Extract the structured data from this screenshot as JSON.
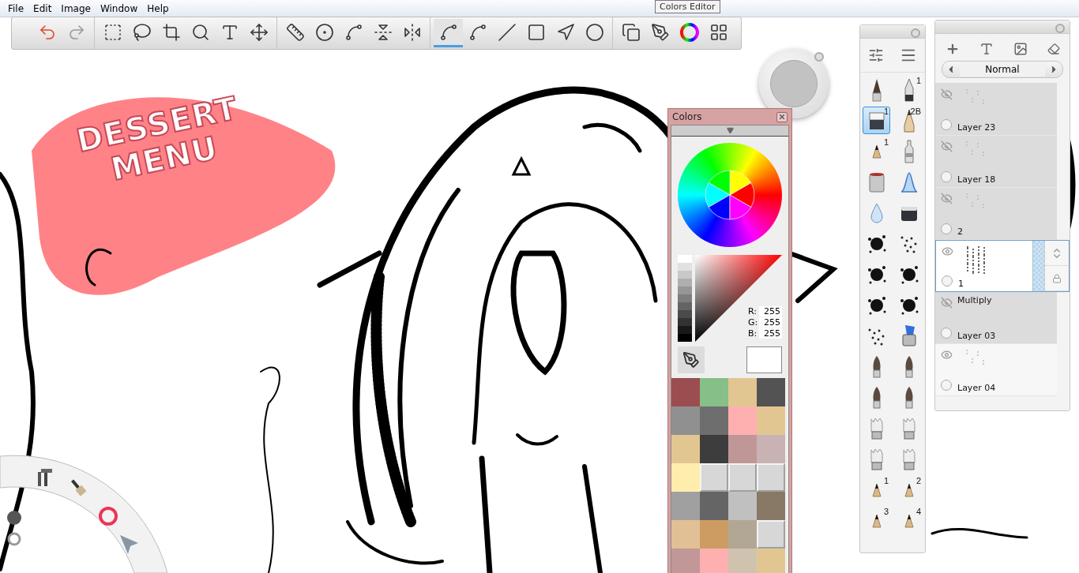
{
  "menu": [
    "File",
    "Edit",
    "Image",
    "Window",
    "Help"
  ],
  "tooltip": "Colors Editor",
  "toolbar": {
    "groups": [
      {
        "tools": [
          {
            "selected": false
          },
          {
            "selected": false
          }
        ]
      },
      {
        "tools": [
          {
            "selected": false
          },
          {
            "selected": false
          },
          {
            "selected": false
          },
          {
            "selected": false
          },
          {
            "selected": false
          },
          {
            "selected": false
          }
        ]
      },
      {
        "tools": [
          {
            "selected": false
          },
          {
            "selected": false
          },
          {
            "selected": false
          },
          {
            "selected": false
          },
          {
            "selected": false
          }
        ]
      },
      {
        "tools": [
          {
            "selected": true
          },
          {
            "selected": false
          },
          {
            "selected": false
          },
          {
            "selected": false
          },
          {
            "selected": false
          },
          {
            "selected": false
          }
        ]
      },
      {
        "tools": [
          {
            "selected": false
          },
          {
            "selected": false
          },
          {
            "selected": false
          },
          {
            "selected": false
          }
        ]
      }
    ]
  },
  "canvas_art": {
    "lettering": [
      "DESSERT",
      "MENU"
    ]
  },
  "colors_panel": {
    "title": "Colors",
    "rgb": [
      {
        "label": "R:",
        "value": "255"
      },
      {
        "label": "G:",
        "value": "255"
      },
      {
        "label": "B:",
        "value": "255"
      }
    ],
    "swatches": [
      {
        "color": "#9b4d4f",
        "empty": false
      },
      {
        "color": "#86bf88",
        "empty": false
      },
      {
        "color": "#e2c692",
        "empty": false
      },
      {
        "color": "#535353",
        "empty": false
      },
      {
        "color": "#909090",
        "empty": false
      },
      {
        "color": "#6e6e6e",
        "empty": false
      },
      {
        "color": "#feb0b0",
        "empty": false
      },
      {
        "color": "#e2c692",
        "empty": false
      },
      {
        "color": "#e2c692",
        "empty": false
      },
      {
        "color": "#3d3d3d",
        "empty": false
      },
      {
        "color": "#c09797",
        "empty": false
      },
      {
        "color": "#c9b2b4",
        "empty": false
      },
      {
        "color": "#ffedae",
        "empty": false
      },
      {
        "color": "#d7d7d7",
        "empty": true
      },
      {
        "color": "#d7d7d7",
        "empty": true
      },
      {
        "color": "#d7d7d7",
        "empty": true
      },
      {
        "color": "#a0a0a0",
        "empty": false
      },
      {
        "color": "#656565",
        "empty": false
      },
      {
        "color": "#c0c0c0",
        "empty": false
      },
      {
        "color": "#877966",
        "empty": false
      },
      {
        "color": "#e1c095",
        "empty": false
      },
      {
        "color": "#cd9c62",
        "empty": false
      },
      {
        "color": "#b1a794",
        "empty": false
      },
      {
        "color": "#d7d7d7",
        "empty": true
      },
      {
        "color": "#c19797",
        "empty": false
      },
      {
        "color": "#feafaf",
        "empty": false
      },
      {
        "color": "#cfc3b0",
        "empty": false
      },
      {
        "color": "#e2c692",
        "empty": false
      }
    ]
  },
  "brushes": [
    {
      "kind": "tip",
      "selected": false
    },
    {
      "kind": "pen",
      "badge": "1",
      "selected": false
    },
    {
      "kind": "eraser",
      "badge": "1",
      "selected": true
    },
    {
      "kind": "pencil",
      "badge": "2B",
      "selected": false
    },
    {
      "kind": "nib",
      "badge": "1",
      "selected": false
    },
    {
      "kind": "marker",
      "selected": false
    },
    {
      "kind": "bucket",
      "selected": false
    },
    {
      "kind": "shape",
      "selected": false
    },
    {
      "kind": "drop",
      "selected": false
    },
    {
      "kind": "block",
      "selected": false
    },
    {
      "kind": "splatter",
      "selected": false
    },
    {
      "kind": "dots",
      "selected": false
    },
    {
      "kind": "splatter",
      "selected": false
    },
    {
      "kind": "splatter",
      "selected": false
    },
    {
      "kind": "splatter",
      "selected": false
    },
    {
      "kind": "splatter",
      "selected": false
    },
    {
      "kind": "dots",
      "selected": false
    },
    {
      "kind": "ink",
      "selected": false
    },
    {
      "kind": "brush",
      "selected": false
    },
    {
      "kind": "brush",
      "selected": false
    },
    {
      "kind": "brush",
      "selected": false
    },
    {
      "kind": "brush",
      "selected": false
    },
    {
      "kind": "flat",
      "selected": false
    },
    {
      "kind": "flat",
      "selected": false
    },
    {
      "kind": "flat",
      "selected": false
    },
    {
      "kind": "flat",
      "selected": false
    },
    {
      "kind": "nib",
      "badge": "1",
      "selected": false
    },
    {
      "kind": "nib",
      "badge": "2",
      "selected": false
    },
    {
      "kind": "nib",
      "badge": "3",
      "selected": false
    },
    {
      "kind": "nib",
      "badge": "4",
      "selected": false
    }
  ],
  "layers_panel": {
    "blend_mode": "Normal",
    "layers": [
      {
        "name": "Layer 23",
        "visible": false,
        "selected": false
      },
      {
        "name": "Layer 18",
        "visible": false,
        "selected": false
      },
      {
        "name": "2",
        "visible": false,
        "selected": false
      },
      {
        "name": "1",
        "visible": true,
        "selected": true
      },
      {
        "name": "Layer 03",
        "blend": "Multiply",
        "visible": false,
        "selected": false
      },
      {
        "name": "Layer 04",
        "visible": true,
        "selected": false
      }
    ]
  }
}
